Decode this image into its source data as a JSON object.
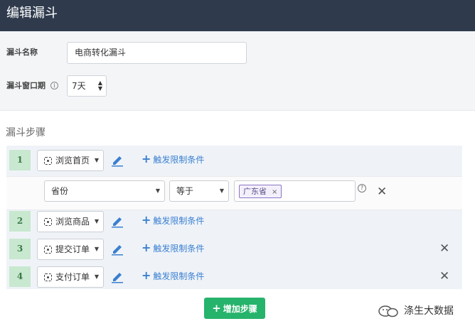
{
  "header": {
    "title": "编辑漏斗"
  },
  "form": {
    "name_label": "漏斗名称",
    "name_value": "电商转化漏斗",
    "period_label": "漏斗窗口期",
    "period_value": "7天"
  },
  "steps_section": {
    "title": "漏斗步骤"
  },
  "steps": [
    {
      "number": "1",
      "event": "浏览首页",
      "add_condition": "触发限制条件"
    },
    {
      "number": "2",
      "event": "浏览商品",
      "add_condition": "触发限制条件"
    },
    {
      "number": "3",
      "event": "提交订单",
      "add_condition": "触发限制条件"
    },
    {
      "number": "4",
      "event": "支付订单",
      "add_condition": "触发限制条件"
    }
  ],
  "filter": {
    "property": "省份",
    "operator": "等于",
    "tag_value": "广东省"
  },
  "actions": {
    "add_step_label": "增加步骤"
  },
  "watermark": {
    "text": "涤生大数据"
  },
  "colors": {
    "header_bg": "#2f3b4d",
    "accent_green": "#26b36b",
    "link_blue": "#3a7fd0",
    "step_number_bg": "#c8e8cf"
  }
}
